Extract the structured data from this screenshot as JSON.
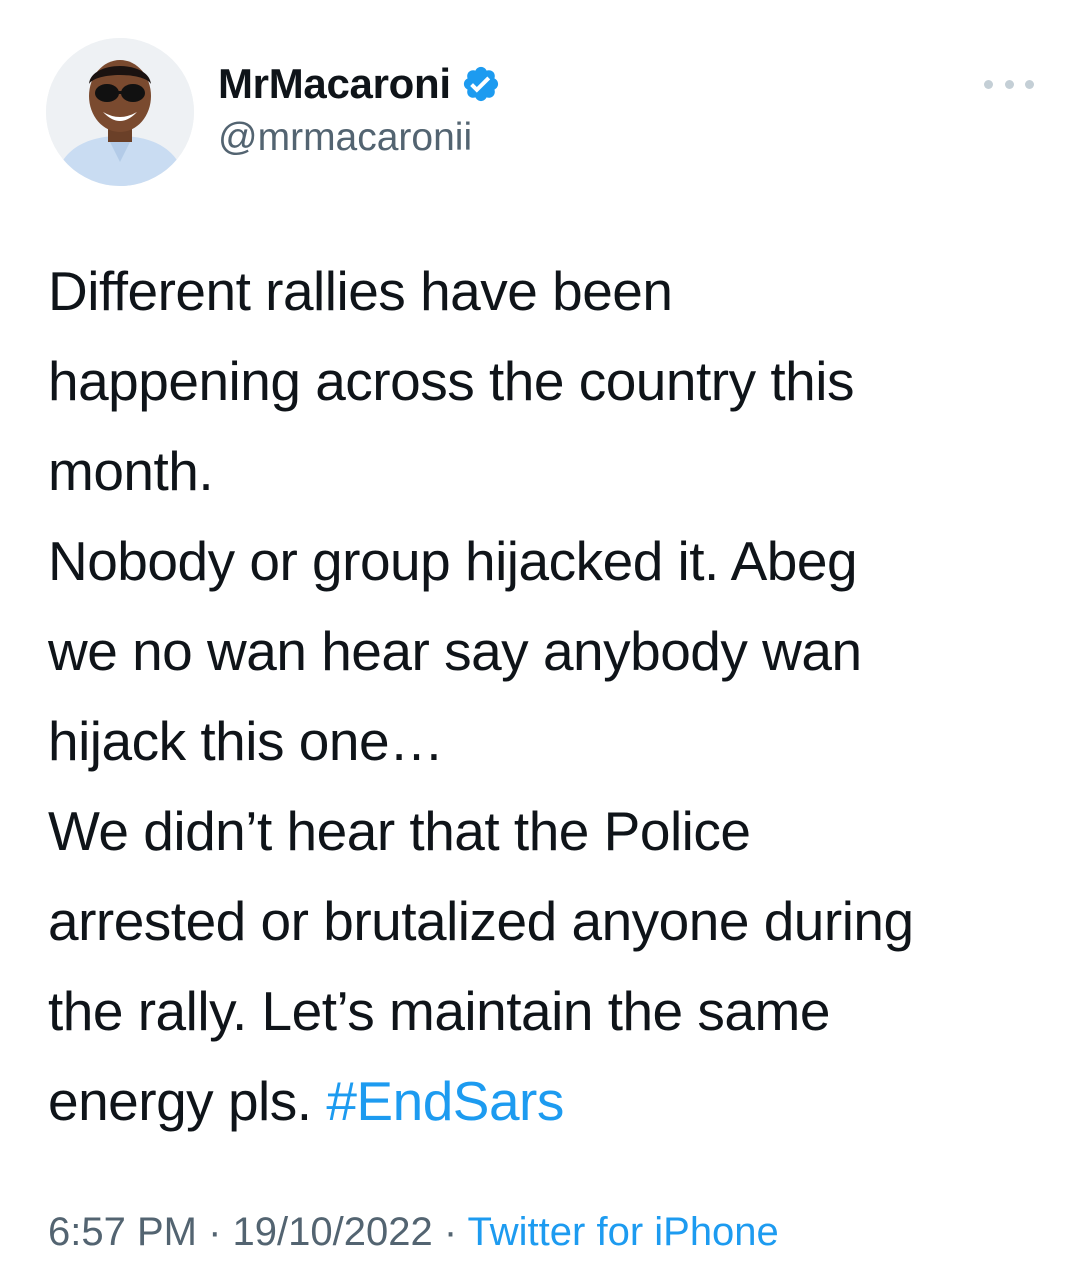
{
  "author": {
    "display_name": "MrMacaroni",
    "handle": "@mrmacaronii",
    "verified": true
  },
  "tweet": {
    "lines": [
      "Different rallies have been",
      "happening across the country this",
      "month.",
      "Nobody or group hijacked it. Abeg",
      "we no wan hear say anybody wan",
      "hijack this one…",
      "We didn’t hear that the Police",
      "arrested or brutalized anyone during",
      "the rally. Let’s maintain the same"
    ],
    "last_line_text": "energy pls.",
    "hashtag": "#EndSars"
  },
  "meta": {
    "time": "6:57 PM",
    "separator": " · ",
    "date": "19/10/2022",
    "source": "Twitter for iPhone"
  },
  "icons": {
    "verified": "verified-badge-icon",
    "more": "more-options-icon"
  },
  "colors": {
    "accent": "#1d9bf0",
    "text": "#0f1419",
    "secondary": "#536471"
  }
}
